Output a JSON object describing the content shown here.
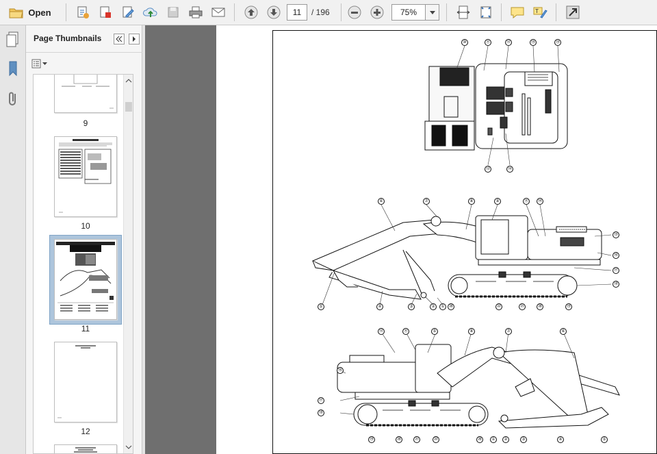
{
  "toolbar": {
    "open_label": "Open",
    "current_page": "11",
    "total_pages": "/ 196",
    "zoom": "75%"
  },
  "panel": {
    "title": "Page Thumbnails"
  },
  "thumbnails": [
    {
      "label": "9"
    },
    {
      "label": "10"
    },
    {
      "label": "11",
      "selected": true
    },
    {
      "label": "12"
    }
  ],
  "callouts": {
    "top_view": [
      "⑩",
      "⑪",
      "⑫",
      "⑮",
      "⑮",
      "⑬",
      "⑭"
    ],
    "side_view": [
      "⑥",
      "⑦",
      "⑧",
      "⑨",
      "⑪",
      "⑭",
      "⑮",
      "⑯",
      "⑰",
      "⑱",
      "⑲",
      "⑳",
      "㉑",
      "㉒",
      "⑳",
      "⑤",
      "④",
      "③",
      "②",
      "①"
    ],
    "rear_view": [
      "⑫",
      "⑪",
      "⑤",
      "⑧",
      "⑦",
      "⑥",
      "⑯",
      "⑰",
      "⑱",
      "⑲",
      "⑳",
      "㉑",
      "㉒",
      "⑳",
      "①",
      "②",
      "③",
      "④",
      "⑤"
    ]
  },
  "colors": {
    "toolbar_bg": "#f1f1f1",
    "selection": "#adc5dc",
    "viewer_gray": "#6f6f6f",
    "accent_blue": "#2f6db5"
  }
}
